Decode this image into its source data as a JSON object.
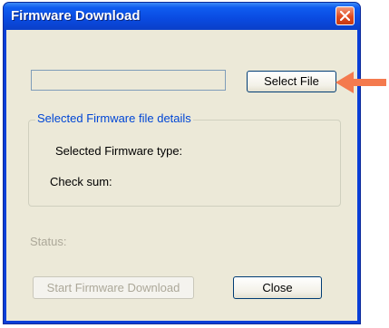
{
  "window": {
    "title": "Firmware Download"
  },
  "file_select": {
    "path_value": "",
    "select_label": "Select File"
  },
  "details": {
    "group_label": "Selected Firmware file details",
    "type_label": "Selected Firmware type:",
    "checksum_label": "Check sum:"
  },
  "status": {
    "label": "Status:"
  },
  "buttons": {
    "start_label": "Start Firmware Download",
    "close_label": "Close"
  },
  "colors": {
    "titlebar": "#0a4ae0",
    "close_button": "#e04a20",
    "groupbox_label": "#0046d5",
    "annotation_arrow": "#f47a4e"
  }
}
